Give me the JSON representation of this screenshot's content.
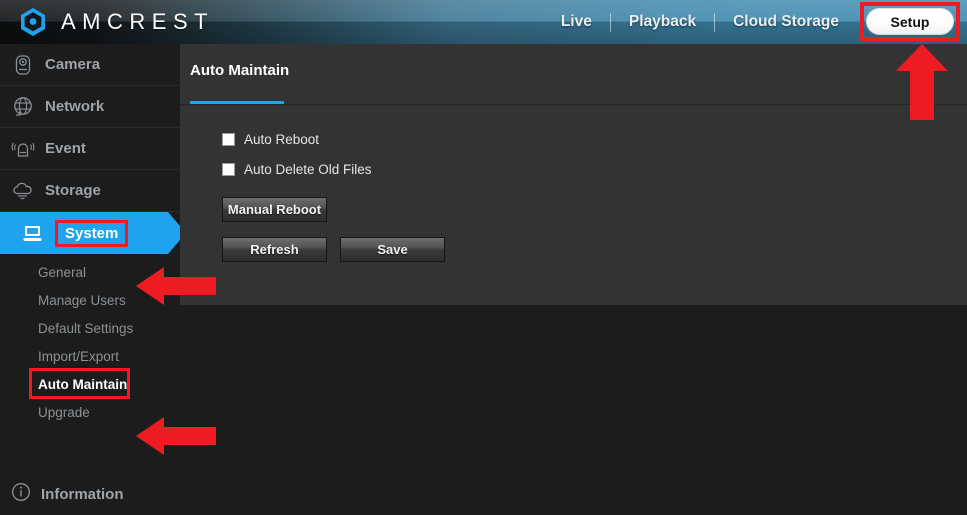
{
  "header": {
    "brand": "AMCREST",
    "logo_icon": "amcrest-hex-logo",
    "nav": [
      {
        "label": "Live"
      },
      {
        "label": "Playback"
      },
      {
        "label": "Cloud Storage"
      }
    ],
    "setup_label": "Setup",
    "accent_color": "#1fa3ee",
    "annotation_color": "#ee1c22"
  },
  "sidebar": {
    "items": [
      {
        "label": "Camera",
        "icon": "camera-icon",
        "active": false
      },
      {
        "label": "Network",
        "icon": "globe-icon",
        "active": false
      },
      {
        "label": "Event",
        "icon": "alarm-bell-icon",
        "active": false
      },
      {
        "label": "Storage",
        "icon": "cloud-icon",
        "active": false
      },
      {
        "label": "System",
        "icon": "monitor-icon",
        "active": true
      }
    ],
    "submenu": [
      {
        "label": "General",
        "current": false
      },
      {
        "label": "Manage Users",
        "current": false
      },
      {
        "label": "Default Settings",
        "current": false
      },
      {
        "label": "Import/Export",
        "current": false
      },
      {
        "label": "Auto Maintain",
        "current": true
      },
      {
        "label": "Upgrade",
        "current": false
      }
    ],
    "information": {
      "label": "Information",
      "icon": "info-circle-icon"
    }
  },
  "content": {
    "tab_label": "Auto Maintain",
    "checkboxes": [
      {
        "label": "Auto Reboot",
        "checked": false
      },
      {
        "label": "Auto Delete Old Files",
        "checked": false
      }
    ],
    "manual_reboot_label": "Manual Reboot",
    "refresh_label": "Refresh",
    "save_label": "Save"
  },
  "annotations": {
    "arrow_up": "red-arrow-up",
    "arrow_system": "red-arrow-left",
    "arrow_auto_maintain": "red-arrow-left"
  }
}
